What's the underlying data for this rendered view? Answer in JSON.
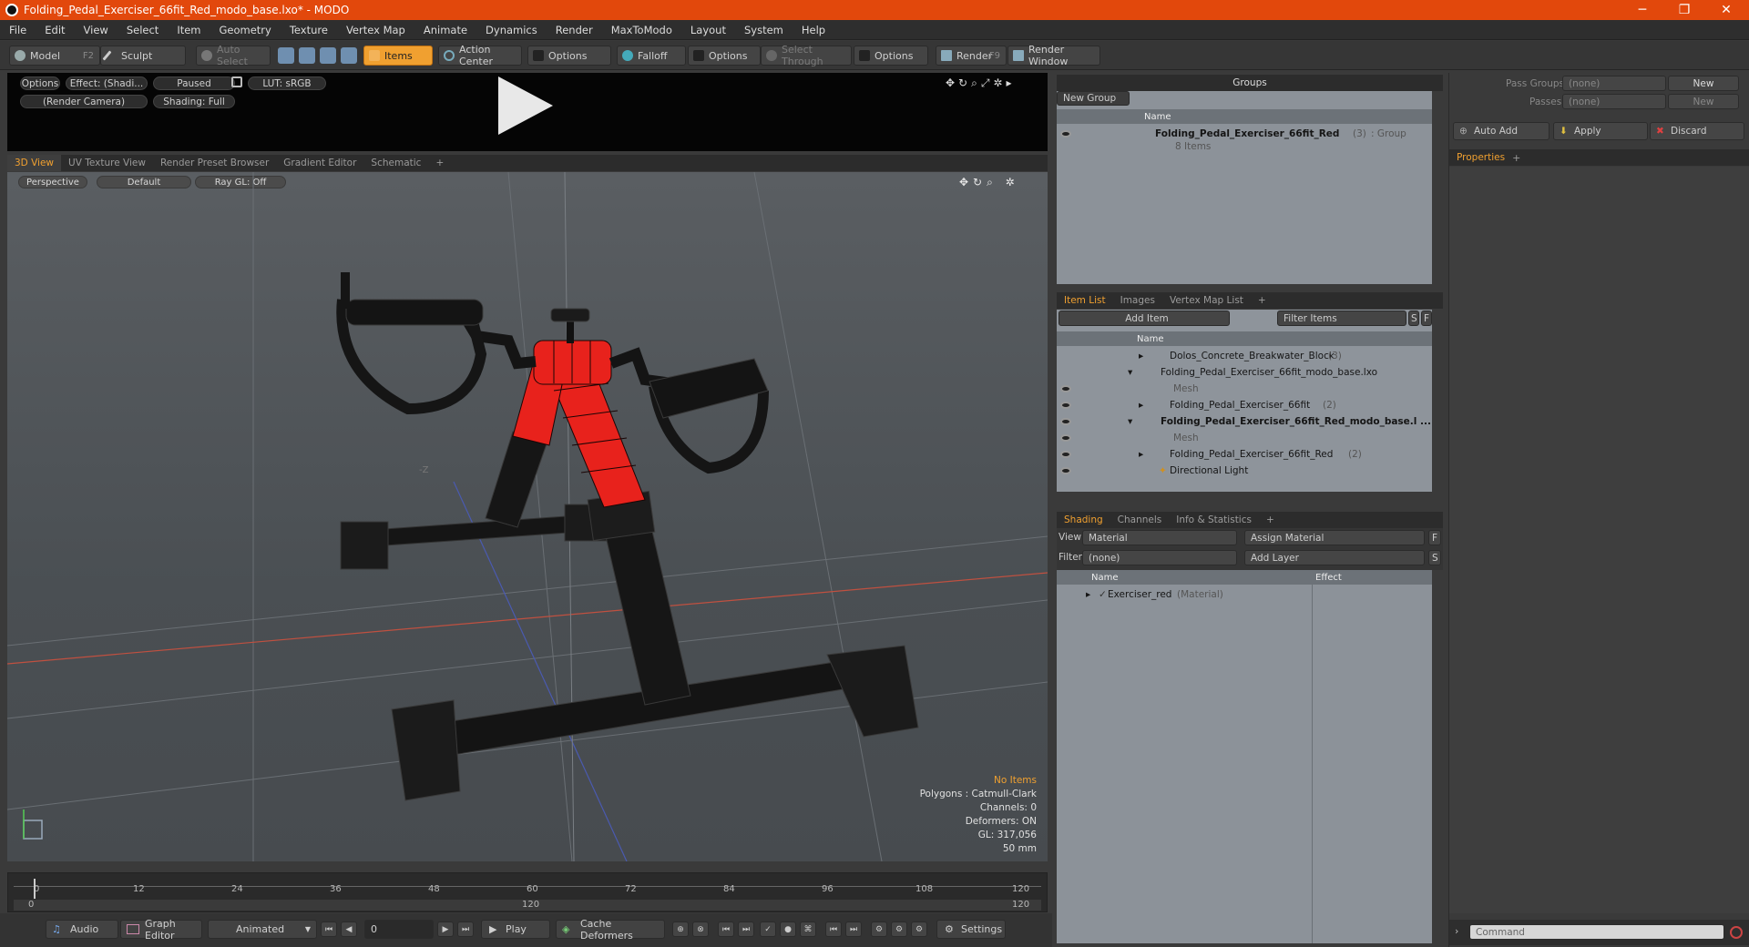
{
  "window": {
    "title": "Folding_Pedal_Exerciser_66fit_Red_modo_base.lxo* - MODO",
    "minimize": "─",
    "maximize": "❐",
    "close": "✕"
  },
  "menu": [
    "File",
    "Edit",
    "View",
    "Select",
    "Item",
    "Geometry",
    "Texture",
    "Vertex Map",
    "Animate",
    "Dynamics",
    "Render",
    "MaxToModo",
    "Layout",
    "System",
    "Help"
  ],
  "toolbar": {
    "model": "Model",
    "model_key": "F2",
    "sculpt": "Sculpt",
    "auto_select": "Auto Select",
    "items": "Items",
    "action_center": "Action Center",
    "options1": "Options",
    "falloff": "Falloff",
    "options2": "Options",
    "select_through": "Select Through",
    "options3": "Options",
    "render": "Render",
    "render_key": "F9",
    "render_window": "Render Window"
  },
  "preview": {
    "options": "Options",
    "effect": "Effect: (Shadi...",
    "paused": "Paused",
    "lut": "LUT: sRGB",
    "camera": "(Render Camera)",
    "shading": "Shading: Full"
  },
  "viewport_tabs": [
    "3D View",
    "UV Texture View",
    "Render Preset Browser",
    "Gradient Editor",
    "Schematic",
    "+"
  ],
  "viewport": {
    "perspective": "Perspective",
    "default": "Default",
    "raygl": "Ray GL: Off",
    "axis_label": "-Z",
    "stats": {
      "no_items": "No Items",
      "polygons": "Polygons : Catmull-Clark",
      "channels": "Channels: 0",
      "deformers": "Deformers: ON",
      "gl": "GL: 317,056",
      "mm": "50 mm"
    }
  },
  "timeline": {
    "ticks": [
      "0",
      "12",
      "24",
      "36",
      "48",
      "60",
      "72",
      "84",
      "96",
      "108",
      "120"
    ],
    "start": "0",
    "mid": "120",
    "end": "120"
  },
  "bottombar": {
    "audio": "Audio",
    "graph_editor": "Graph Editor",
    "animated": "Animated",
    "frame": "0",
    "play": "Play",
    "cache_deformers": "Cache Deformers",
    "settings": "Settings"
  },
  "groups": {
    "title": "Groups",
    "new_group": "New Group",
    "col_name": "Name",
    "item_name": "Folding_Pedal_Exerciser_66fit_Red",
    "item_count": "(3)",
    "item_type": ": Group",
    "item_sub": "8 Items"
  },
  "item_list": {
    "tabs": [
      "Item List",
      "Images",
      "Vertex Map List",
      "+"
    ],
    "add_item": "Add Item",
    "filter": "Filter Items",
    "s": "S",
    "f": "F",
    "col_name": "Name",
    "rows": [
      {
        "name": "Dolos_Concrete_Breakwater_Block",
        "count": "(3)"
      },
      {
        "name": "Folding_Pedal_Exerciser_66fit_modo_base.lxo",
        "count": ""
      },
      {
        "name": "Mesh",
        "count": ""
      },
      {
        "name": "Folding_Pedal_Exerciser_66fit",
        "count": "(2)"
      },
      {
        "name": "Folding_Pedal_Exerciser_66fit_Red_modo_base.l ...",
        "count": ""
      },
      {
        "name": "Mesh",
        "count": ""
      },
      {
        "name": "Folding_Pedal_Exerciser_66fit_Red",
        "count": "(2)"
      },
      {
        "name": "Directional Light",
        "count": ""
      }
    ]
  },
  "shading": {
    "tabs": [
      "Shading",
      "Channels",
      "Info & Statistics",
      "+"
    ],
    "view_label": "View",
    "view_value": "Material",
    "assign": "Assign Material",
    "f": "F",
    "filter_label": "Filter",
    "filter_value": "(none)",
    "add_layer": "Add Layer",
    "s": "S",
    "col_name": "Name",
    "col_effect": "Effect",
    "row_name": "Exerciser_red",
    "row_type": "(Material)"
  },
  "passes": {
    "pass_groups": "Pass Groups",
    "pass_groups_value": "(none)",
    "passes": "Passes",
    "passes_value": "(none)",
    "new1": "New",
    "new2": "New"
  },
  "actions": {
    "auto_add": "Auto Add",
    "apply": "Apply",
    "discard": "Discard"
  },
  "properties": {
    "tab": "Properties",
    "plus": "+"
  },
  "command": {
    "placeholder": "Command"
  },
  "colors": {
    "accent": "#f0a030",
    "titlebar": "#e2480c",
    "model_red": "#e8221c"
  }
}
